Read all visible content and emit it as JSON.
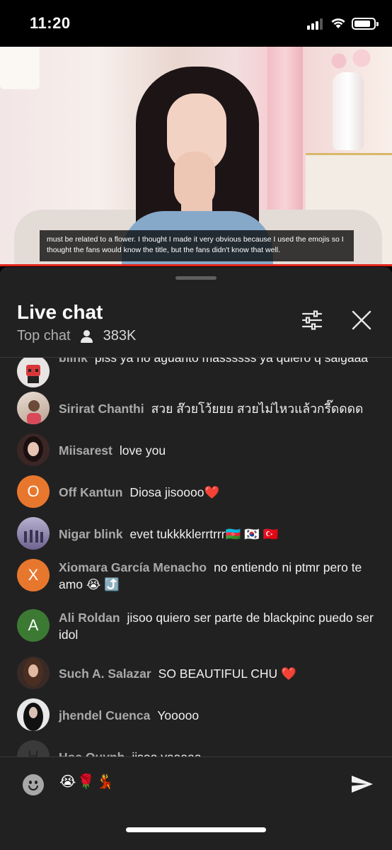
{
  "status_bar": {
    "time": "11:20",
    "signal_icon": "signal-bars-icon",
    "wifi_icon": "wifi-icon",
    "battery_icon": "battery-icon"
  },
  "video": {
    "caption_lines": [
      "must be related to a flower. I thought I made it very obvious because I used the emojis so I",
      "thought the fans would know the title, but the fans didn't know that well."
    ],
    "progress_color": "#e0241b"
  },
  "chat": {
    "title": "Live chat",
    "mode": "Top chat",
    "viewers": "383K",
    "filter_icon": "sliders-icon",
    "close_icon": "close-icon",
    "messages": [
      {
        "author": "blink",
        "text": "piss ya no aguanto massssss ya quiero q salgaaa",
        "avatar": "image",
        "avatar_color": "#d9d9d9"
      },
      {
        "author": "Sirirat Chanthi",
        "text": "สวย ส๊วยโว้ยยย สวยไม่ไหวแล้วกรี๊ดดดด",
        "avatar": "image",
        "avatar_color": "#c9b9a8"
      },
      {
        "author": "Miisarest",
        "text": "love you",
        "avatar": "image",
        "avatar_color": "#5a3a3a"
      },
      {
        "author": "Off Kantun",
        "text": "Diosa jisoooo❤️",
        "avatar_letter": "O",
        "avatar_color": "#e8772e"
      },
      {
        "author": "Nigar blink",
        "text": "evet tukkkklerrtrrr🇦🇿 🇰🇷 🇹🇷",
        "avatar": "image",
        "avatar_color": "#8a7ea8"
      },
      {
        "author": "Xiomara García Menacho",
        "text": "no entiendo ni ptmr pero te amo 😭 ⤴️",
        "avatar_letter": "X",
        "avatar_color": "#e8772e"
      },
      {
        "author": "Ali Roldan",
        "text": "jisoo quiero ser parte de blackpinc puedo ser idol",
        "avatar_letter": "A",
        "avatar_color": "#3c7a34"
      },
      {
        "author": "Such A. Salazar",
        "text": "SO BEAUTIFUL CHU ❤️",
        "avatar": "image",
        "avatar_color": "#3a2a26"
      },
      {
        "author": "jhendel Cuenca",
        "text": "Yooooo",
        "avatar": "image",
        "avatar_color": "#2b2b2b"
      },
      {
        "author": "Hoa Quynh",
        "text": "jisoo yaaaaa",
        "avatar_letter": "H",
        "avatar_color": "#3a3a3a"
      }
    ]
  },
  "composer": {
    "emoji_icon": "emoji-smiley-icon",
    "input_value": "😭🌹💃",
    "send_icon": "send-icon"
  }
}
